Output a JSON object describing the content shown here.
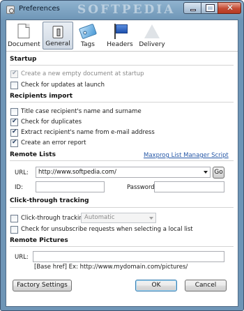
{
  "window": {
    "title": "Preferences",
    "watermark": "SOFTPEDIA"
  },
  "toolbar": {
    "items": [
      {
        "label": "Document",
        "icon": "document-icon"
      },
      {
        "label": "General",
        "icon": "general-icon",
        "selected": true
      },
      {
        "label": "Tags",
        "icon": "tag-icon"
      },
      {
        "label": "Headers",
        "icon": "flag-icon"
      },
      {
        "label": "Delivery",
        "icon": "paper-plane-icon"
      }
    ]
  },
  "startup": {
    "title": "Startup",
    "create_empty": {
      "label": "Create a new empty document at startup",
      "checked": true,
      "disabled": true
    },
    "check_updates": {
      "label": "Check for updates at launch",
      "checked": false
    }
  },
  "recipients_import": {
    "title": "Recipients import",
    "title_case": {
      "label": "Title case recipient's name and surname",
      "checked": false
    },
    "check_duplicates": {
      "label": "Check for duplicates",
      "checked": true
    },
    "extract_name": {
      "label": "Extract recipient's name from e-mail address",
      "checked": true
    },
    "error_report": {
      "label": "Create an error report",
      "checked": true
    }
  },
  "remote_lists": {
    "title": "Remote Lists",
    "link": "Maxprog List Manager Script",
    "url_label": "URL:",
    "url_value": "http://www.softpedia.com/",
    "go_label": "Go",
    "id_label": "ID:",
    "id_value": "",
    "password_label": "Password:",
    "password_value": ""
  },
  "click_through": {
    "title": "Click-through tracking",
    "tracking": {
      "label": "Click-through tracking",
      "checked": false
    },
    "mode_value": "Automatic",
    "unsubscribe": {
      "label": "Check for unsubscribe requests when selecting a local list",
      "checked": false
    }
  },
  "remote_pictures": {
    "title": "Remote Pictures",
    "url_label": "URL:",
    "url_value": "",
    "hint": "[Base href] Ex: http://www.mydomain.com/pictures/"
  },
  "buttons": {
    "factory": "Factory Settings",
    "ok": "OK",
    "cancel": "Cancel"
  },
  "colors": {
    "link": "#2456a6",
    "titlebar": "#6e95b6",
    "close": "#c44a33"
  }
}
